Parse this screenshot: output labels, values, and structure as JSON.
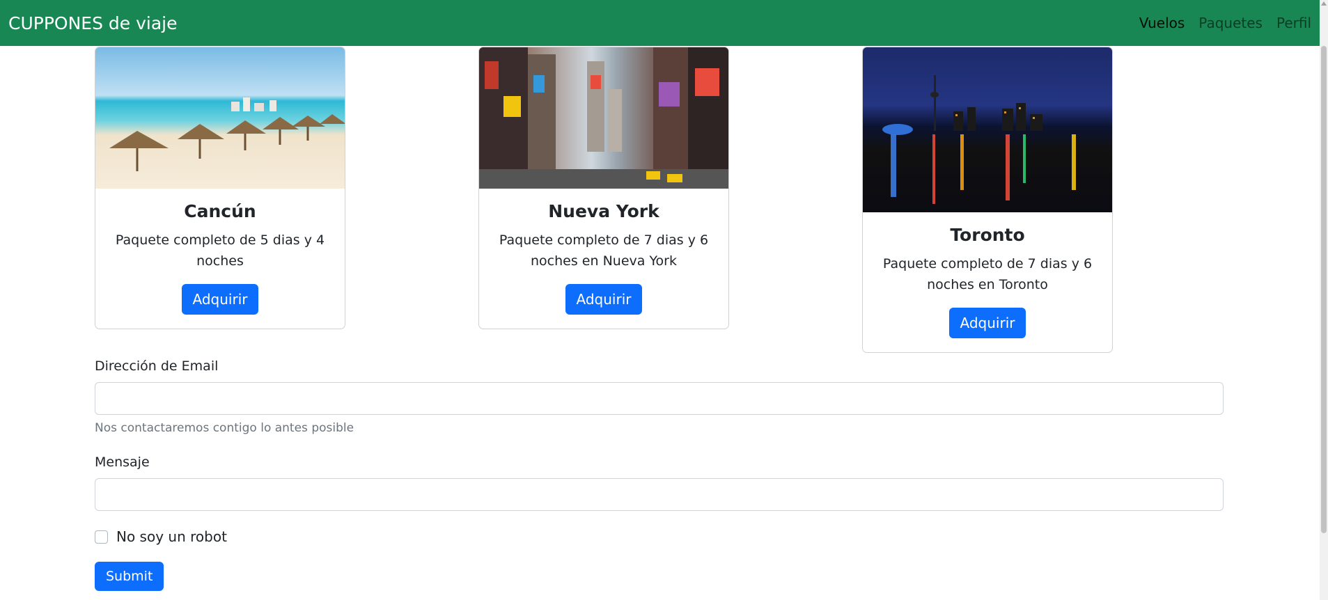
{
  "navbar": {
    "brand": "CUPPONES de viaje",
    "links": [
      {
        "label": "Vuelos",
        "active": true
      },
      {
        "label": "Paquetes",
        "active": false
      },
      {
        "label": "Perfil",
        "active": false
      }
    ],
    "background": "#198754"
  },
  "cards": [
    {
      "title": "Cancún",
      "text": "Paquete completo de 5 dias y 4 noches",
      "button": "Adquirir",
      "image": "beach-photo"
    },
    {
      "title": "Nueva York",
      "text": "Paquete completo de 7 dias y 6 noches en Nueva York",
      "button": "Adquirir",
      "image": "times-square-photo"
    },
    {
      "title": "Toronto",
      "text": "Paquete completo de 7 dias y 6 noches en Toronto",
      "button": "Adquirir",
      "image": "toronto-skyline-photo"
    }
  ],
  "form": {
    "email_label": "Dirección de Email",
    "email_value": "",
    "email_help": "Nos contactaremos contigo lo antes posible",
    "message_label": "Mensaje",
    "message_value": "",
    "robot_label": "No soy un robot",
    "robot_checked": false,
    "submit_label": "Submit"
  },
  "colors": {
    "primary": "#0d6efd",
    "success": "#198754"
  }
}
